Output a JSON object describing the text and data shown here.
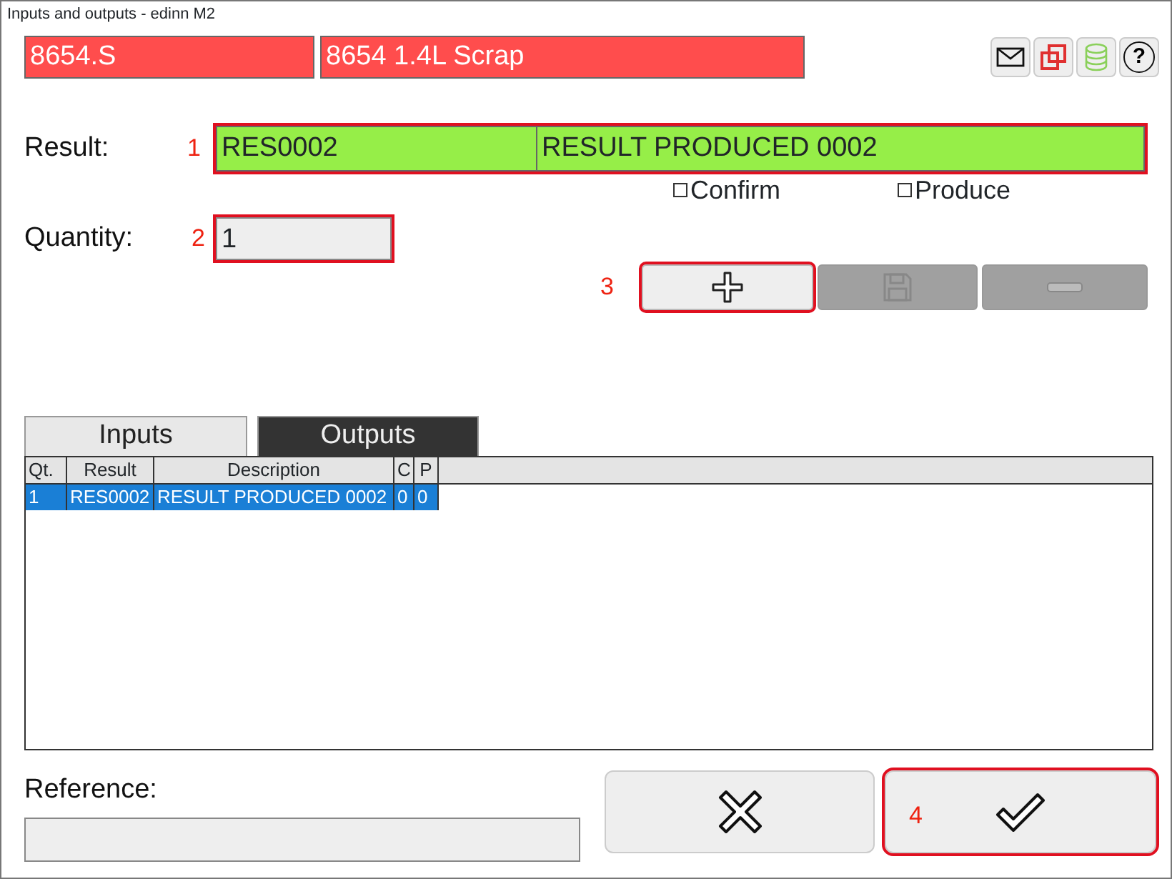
{
  "window": {
    "title": "Inputs and outputs - edinn M2"
  },
  "header": {
    "code": "8654.S",
    "description": "8654 1.4L Scrap"
  },
  "toolbar": [
    {
      "kind": "mail"
    },
    {
      "kind": "windows"
    },
    {
      "kind": "database"
    },
    {
      "kind": "help",
      "label": "?"
    }
  ],
  "result": {
    "label": "Result:",
    "marker": "1",
    "code": "RES0002",
    "description": "RESULT PRODUCED 0002",
    "highlighted": true
  },
  "options": [
    {
      "label": "Confirm",
      "checked": false
    },
    {
      "label": "Produce",
      "checked": false
    }
  ],
  "quantity": {
    "label": "Quantity:",
    "marker": "2",
    "value": "1",
    "highlighted": true
  },
  "actions": {
    "marker": "3",
    "buttons": [
      {
        "kind": "add",
        "disabled": false,
        "highlighted": true
      },
      {
        "kind": "save",
        "disabled": true,
        "highlighted": false
      },
      {
        "kind": "remove",
        "disabled": true,
        "highlighted": false
      }
    ]
  },
  "tabs": [
    {
      "label": "Inputs",
      "selected": false
    },
    {
      "label": "Outputs",
      "selected": true
    }
  ],
  "table": {
    "columns": [
      "Qt.",
      "Result",
      "Description",
      "C",
      "P"
    ],
    "rows": [
      {
        "cells": [
          "1",
          "RES0002",
          "RESULT PRODUCED 0002",
          "0",
          "0"
        ],
        "selected": true
      }
    ]
  },
  "reference": {
    "label": "Reference:"
  },
  "footer": {
    "buttons": [
      {
        "kind": "cancel",
        "highlighted": false
      },
      {
        "kind": "confirm",
        "highlighted": true,
        "marker": "4"
      }
    ]
  }
}
